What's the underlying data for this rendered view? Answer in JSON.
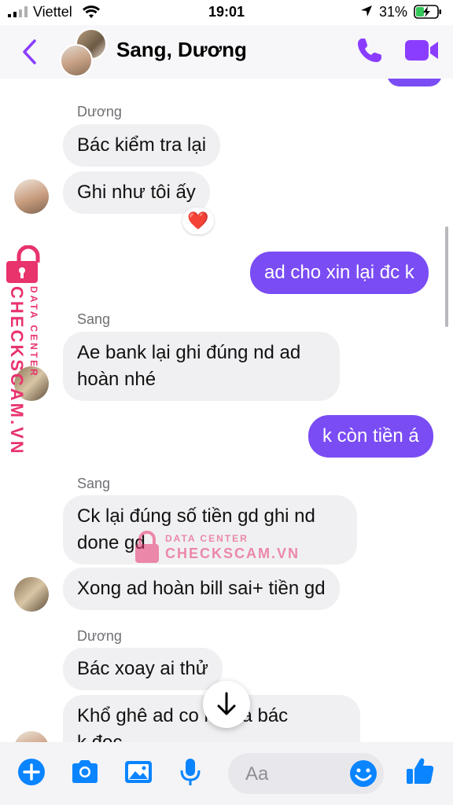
{
  "status_bar": {
    "carrier": "Viettel",
    "time": "19:01",
    "battery_percent": "31%"
  },
  "header": {
    "title": "Sang, Dương",
    "back_icon": "chevron-left-icon",
    "call_icon": "phone-icon",
    "video_icon": "video-camera-icon",
    "accent_color": "#8b3dff"
  },
  "messages": [
    {
      "sender": "Dương",
      "direction": "in",
      "text": "Bác kiểm tra lại"
    },
    {
      "direction": "in",
      "text": "Ghi như tôi ấy",
      "reaction": "❤️"
    },
    {
      "direction": "out",
      "text": "ad cho xin lại đc k"
    },
    {
      "sender": "Sang",
      "direction": "in",
      "text_line1": "Ae bank lại ghi đúng nd ad",
      "text_line2": "hoàn nhé"
    },
    {
      "direction": "out",
      "text": "k còn tiền á"
    },
    {
      "sender": "Sang",
      "direction": "in",
      "text_line1": "Ck lại đúng số tiền gd ghi nd",
      "text_line2": "done gd"
    },
    {
      "direction": "in",
      "text": "Xong ad hoàn bill sai+ tiền gd"
    },
    {
      "sender": "Dương",
      "direction": "in",
      "text": "Bác xoay ai thử"
    },
    {
      "direction": "in",
      "text_line1": "Khổ ghê ad co    rõ mà bác",
      "text_line2": "k đọc"
    }
  ],
  "watermark": {
    "side_brand": "CHECKSCAM.VN",
    "side_tag": "DATA CENTER",
    "center_tag": "DATA CENTER",
    "center_brand": "CHECKSCAM.VN",
    "color": "#e8336d"
  },
  "composer": {
    "placeholder": "Aa",
    "icons": [
      "plus-icon",
      "camera-icon",
      "image-icon",
      "microphone-icon",
      "emoji-icon",
      "thumbs-up-icon"
    ],
    "icon_color": "#0a84ff"
  },
  "colors": {
    "outgoing_bubble": "#7a4cf4",
    "incoming_bubble": "#f0f0f2"
  }
}
